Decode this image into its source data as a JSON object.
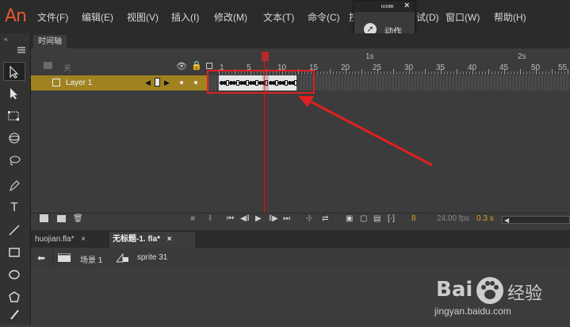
{
  "app": {
    "logo": "An"
  },
  "menubar": {
    "items": [
      "文件(F)",
      "编辑(E)",
      "视图(V)",
      "插入(I)",
      "修改(M)",
      "文本(T)",
      "命令(C)",
      "控",
      "试(D)",
      "窗口(W)",
      "帮助(H)"
    ]
  },
  "action_panel": {
    "expand_glyph": "»",
    "close_glyph": "×",
    "icon": "arrow-up-right-icon",
    "label": "动作"
  },
  "toolbar": {
    "collapse_glyph": "«",
    "tools": [
      "selection-tool-icon",
      "subselection-tool-icon",
      "free-transform-icon",
      "3d-rotation-icon",
      "lasso-icon",
      "pen-icon",
      "text-tool-icon",
      "line-tool-icon",
      "rectangle-tool-icon",
      "oval-tool-icon",
      "polystar-tool-icon",
      "brush-tool-icon"
    ],
    "text_tool_glyph": "T"
  },
  "timeline": {
    "tab_label": "时间轴",
    "header_label": "关",
    "seconds": [
      "1s",
      "2s"
    ],
    "frame_numbers": [
      "1",
      "5",
      "10",
      "15",
      "20",
      "25",
      "30",
      "35",
      "40",
      "45",
      "50",
      "55"
    ],
    "current_frame": 8,
    "fps": "24.00 fps",
    "elapsed": "0.3 s",
    "layer": {
      "name": "Layer 1",
      "frames_filled": 24
    }
  },
  "documents": {
    "tabs": [
      {
        "name": "huojian.fla*",
        "close": "×"
      },
      {
        "name": "无标题-1. fla*",
        "close": "×"
      }
    ]
  },
  "breadcrumb": {
    "scene": "场景 1",
    "symbol": "sprite 31"
  },
  "watermark": {
    "brand": "Bai",
    "brand_cn": "经验",
    "url": "jingyan.baidu.com"
  },
  "colors": {
    "layer_highlight": "#a08221",
    "annotation": "#e02020",
    "logo": "#e4572e"
  }
}
